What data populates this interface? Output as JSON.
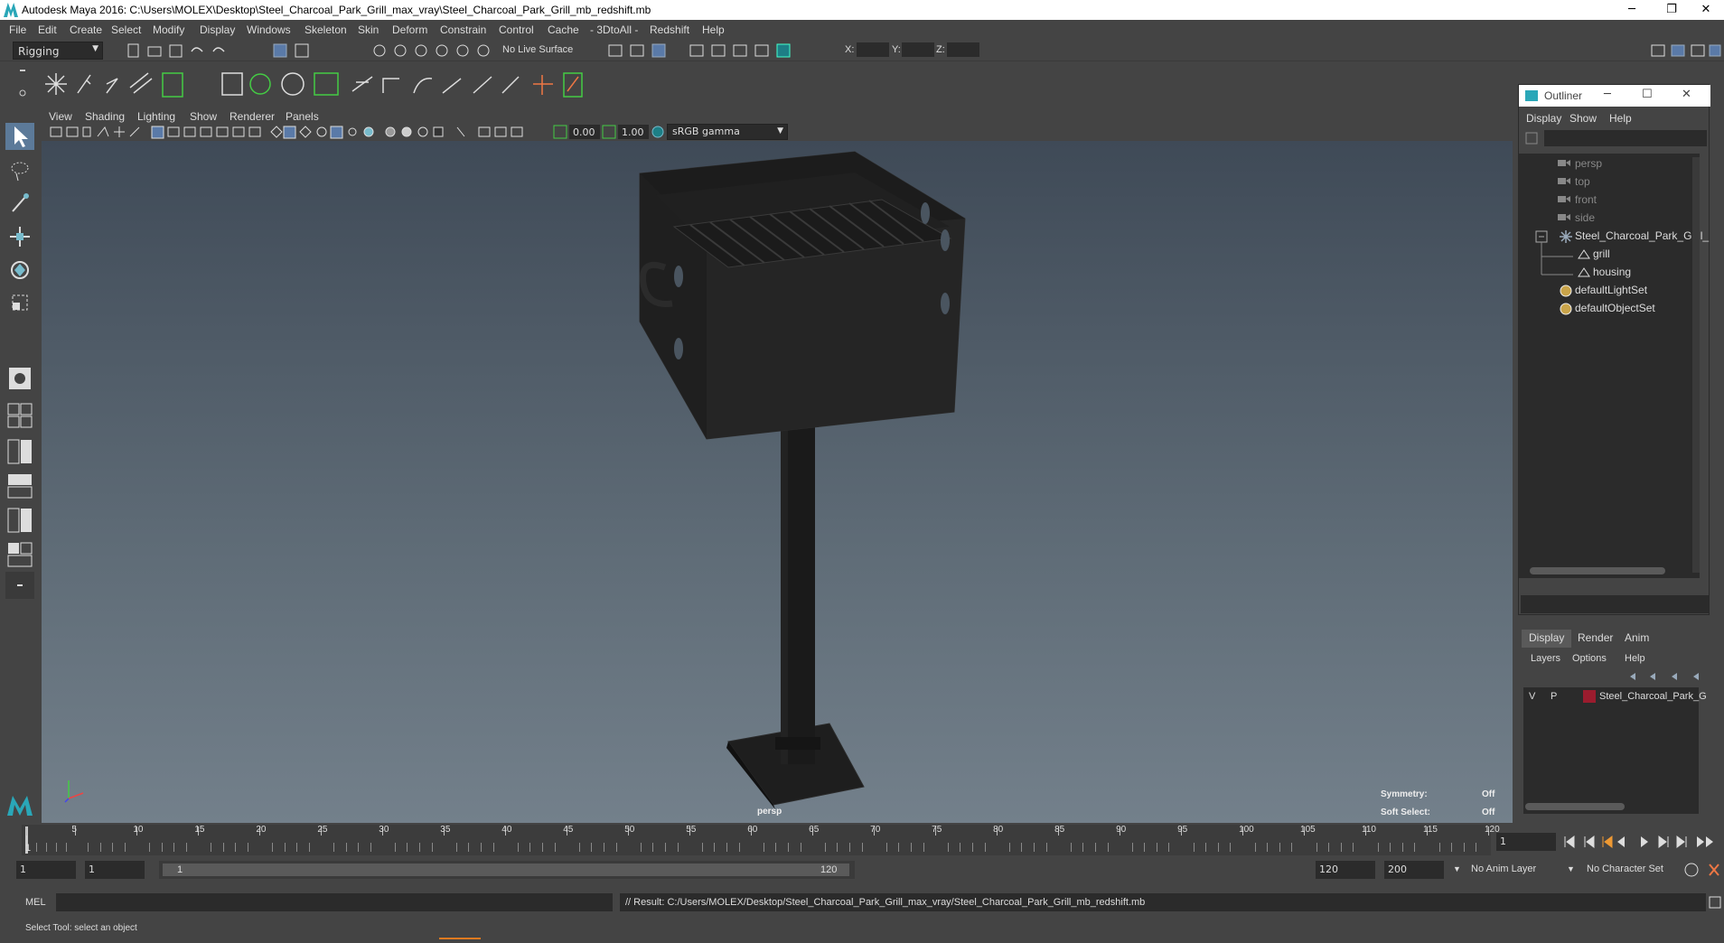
{
  "window": {
    "title": "Autodesk Maya 2016: C:\\Users\\MOLEX\\Desktop\\Steel_Charcoal_Park_Grill_max_vray\\Steel_Charcoal_Park_Grill_mb_redshift.mb",
    "minimize": "─",
    "restore": "❐",
    "close": "✕"
  },
  "menubar": [
    "File",
    "Edit",
    "Create",
    "Select",
    "Modify",
    "Display",
    "Windows",
    "Skeleton",
    "Skin",
    "Deform",
    "Constrain",
    "Control",
    "Cache",
    "- 3DtoAll -",
    "Redshift",
    "Help"
  ],
  "statusline": {
    "menuset": "Rigging",
    "live_surface": "No Live Surface",
    "x_label": "X:",
    "y_label": "Y:",
    "z_label": "Z:"
  },
  "viewport": {
    "menus": [
      "View",
      "Shading",
      "Lighting",
      "Show",
      "Renderer",
      "Panels"
    ],
    "exposure": "0.00",
    "gamma": "1.00",
    "color_space": "sRGB gamma",
    "camera_label": "persp",
    "hud": {
      "symmetry_label": "Symmetry:",
      "symmetry_value": "Off",
      "soft_select_label": "Soft Select:",
      "soft_select_value": "Off"
    }
  },
  "outliner": {
    "title": "Outliner",
    "menus": [
      "Display",
      "Show",
      "Help"
    ],
    "items": [
      {
        "label": "persp",
        "dim": true
      },
      {
        "label": "top",
        "dim": true
      },
      {
        "label": "front",
        "dim": true
      },
      {
        "label": "side",
        "dim": true
      },
      {
        "label": "Steel_Charcoal_Park_Grill_",
        "dim": false
      },
      {
        "label": "grill",
        "dim": false
      },
      {
        "label": "housing",
        "dim": false
      },
      {
        "label": "defaultLightSet",
        "dim": false
      },
      {
        "label": "defaultObjectSet",
        "dim": false
      }
    ]
  },
  "layers": {
    "tabs": [
      "Display",
      "Render",
      "Anim"
    ],
    "menus": [
      "Layers",
      "Options",
      "Help"
    ],
    "layer": {
      "v": "V",
      "p": "P",
      "name": "Steel_Charcoal_Park_G",
      "color": "#9b1c2e"
    }
  },
  "timeline": {
    "ticks": [
      "1",
      "5",
      "10",
      "15",
      "20",
      "25",
      "30",
      "35",
      "40",
      "45",
      "50",
      "55",
      "60",
      "65",
      "70",
      "75",
      "80",
      "85",
      "90",
      "95",
      "100",
      "105",
      "110",
      "115",
      "120"
    ],
    "current_frame": "1"
  },
  "range": {
    "start": "1",
    "playback_start": "1",
    "slider_start": "1",
    "slider_end": "120",
    "playback_end": "120",
    "end": "200",
    "anim_layer": "No Anim Layer",
    "character_set": "No Character Set"
  },
  "cmdline": {
    "mode": "MEL",
    "result": "// Result: C:/Users/MOLEX/Desktop/Steel_Charcoal_Park_Grill_max_vray/Steel_Charcoal_Park_Grill_mb_redshift.mb"
  },
  "helpline": {
    "text": "Select Tool: select an object"
  },
  "colors": {
    "accent": "#2aa7b8",
    "panel": "#444444",
    "field": "#2b2b2b"
  }
}
